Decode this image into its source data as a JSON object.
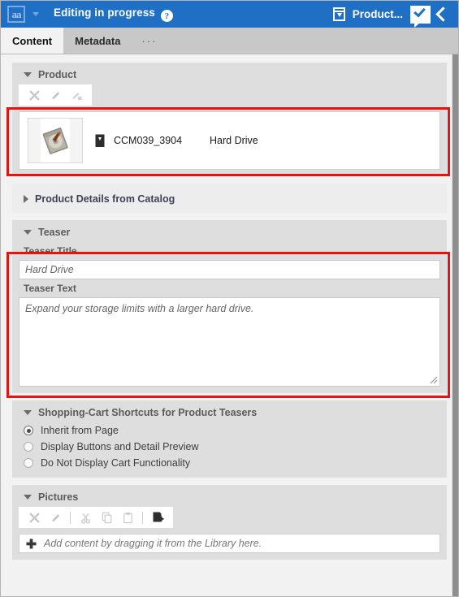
{
  "header": {
    "app_icon": "text-document-icon",
    "dropdown_icon": "chevron-down-icon",
    "title": "Editing in progress",
    "help_icon": "help-icon",
    "help_glyph": "?",
    "document_icon": "product-box-icon",
    "document_name": "Product...",
    "approve_icon": "approval-checkmark-icon",
    "collapse_icon": "chevron-left-icon",
    "background_color": "#1f6fc4"
  },
  "tabs": [
    {
      "label": "Content",
      "active": true
    },
    {
      "label": "Metadata",
      "active": false
    }
  ],
  "tab_overflow": "···",
  "sections": {
    "product": {
      "title": "Product",
      "expanded": true,
      "toolbar": [
        {
          "name": "remove-button",
          "icon": "x-icon",
          "enabled": false
        },
        {
          "name": "edit-button",
          "icon": "pencil-icon",
          "enabled": false
        },
        {
          "name": "edit-in-place-button",
          "icon": "pencil-box-icon",
          "enabled": false
        }
      ],
      "item": {
        "thumbnail": "hard-drive-thumbnail",
        "type_icon": "product-box-icon",
        "id": "CCM039_3904",
        "name": "Hard Drive"
      }
    },
    "product_details": {
      "title": "Product Details from Catalog",
      "expanded": false
    },
    "teaser": {
      "title": "Teaser",
      "expanded": true,
      "title_field": {
        "label": "Teaser Title",
        "value": "Hard Drive"
      },
      "text_field": {
        "label": "Teaser Text",
        "value": "Expand your storage limits with a larger hard drive."
      },
      "resize_icon": "resize-grip-icon"
    },
    "shopping_cart": {
      "title": "Shopping-Cart Shortcuts for Product Teasers",
      "expanded": true,
      "options": [
        {
          "label": "Inherit from Page",
          "selected": true
        },
        {
          "label": "Display Buttons and Detail Preview",
          "selected": false
        },
        {
          "label": "Do Not Display Cart Functionality",
          "selected": false
        }
      ]
    },
    "pictures": {
      "title": "Pictures",
      "expanded": true,
      "toolbar": [
        {
          "name": "remove-button",
          "icon": "x-icon",
          "enabled": false
        },
        {
          "name": "edit-button",
          "icon": "pencil-icon",
          "enabled": false
        },
        {
          "name": "separator-1",
          "icon": "separator",
          "enabled": false
        },
        {
          "name": "cut-button",
          "icon": "scissors-icon",
          "enabled": false
        },
        {
          "name": "copy-button",
          "icon": "copy-icon",
          "enabled": false
        },
        {
          "name": "paste-button",
          "icon": "clipboard-icon",
          "enabled": false
        },
        {
          "name": "separator-2",
          "icon": "separator",
          "enabled": false
        },
        {
          "name": "new-content-button",
          "icon": "new-document-icon",
          "enabled": true
        }
      ],
      "drop_area": {
        "icon": "plus-icon",
        "plus_glyph": "➕",
        "text": "Add content by dragging it from the Library here."
      }
    }
  },
  "annotations": {
    "highlight_color": "#e8120e",
    "boxes": [
      {
        "name": "product-item-highlight"
      },
      {
        "name": "teaser-fields-highlight"
      }
    ]
  },
  "scrollbar": {
    "name": "vertical-scrollbar"
  }
}
